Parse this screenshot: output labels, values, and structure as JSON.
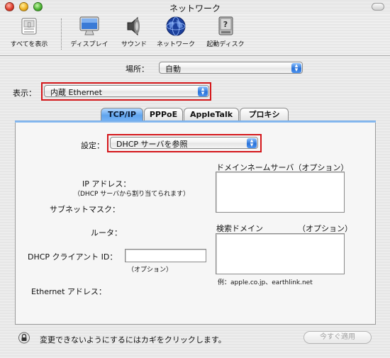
{
  "window": {
    "title": "ネットワーク"
  },
  "toolbar": {
    "items": [
      {
        "label": "すべてを表示",
        "icon": "show-all-icon"
      },
      {
        "label": "ディスプレイ",
        "icon": "display-icon"
      },
      {
        "label": "サウンド",
        "icon": "sound-icon"
      },
      {
        "label": "ネットワーク",
        "icon": "network-icon"
      },
      {
        "label": "起動ディスク",
        "icon": "startup-disk-icon"
      }
    ]
  },
  "location": {
    "label": "場所：",
    "value": "自動"
  },
  "show": {
    "label": "表示：",
    "value": "内蔵 Ethernet"
  },
  "tabs": [
    {
      "label": "TCP/IP",
      "selected": true
    },
    {
      "label": "PPPoE",
      "selected": false
    },
    {
      "label": "AppleTalk",
      "selected": false
    },
    {
      "label": "プロキシ",
      "selected": false
    }
  ],
  "tcpip": {
    "config_label": "設定：",
    "config_value": "DHCP サーバを参照",
    "ip_label": "IP アドレス：",
    "ip_note": "（DHCP サーバから割り当てられます）",
    "subnet_label": "サブネットマスク：",
    "router_label": "ルータ：",
    "client_id_label": "DHCP クライアント ID：",
    "client_id_value": "",
    "client_id_note": "（オプション）",
    "ethernet_label": "Ethernet アドレス：",
    "dns_label": "ドメインネームサーバ（オプション）",
    "search_label": "検索ドメイン",
    "search_optional": "（オプション）",
    "example": "例：apple.co.jp、earthlink.net"
  },
  "footer": {
    "lock_text": "変更できないようにするにはカギをクリックします。",
    "apply_label": "今すぐ適用"
  },
  "colors": {
    "highlight": "#d4161a",
    "tab_selected": "#5fa4ee"
  }
}
